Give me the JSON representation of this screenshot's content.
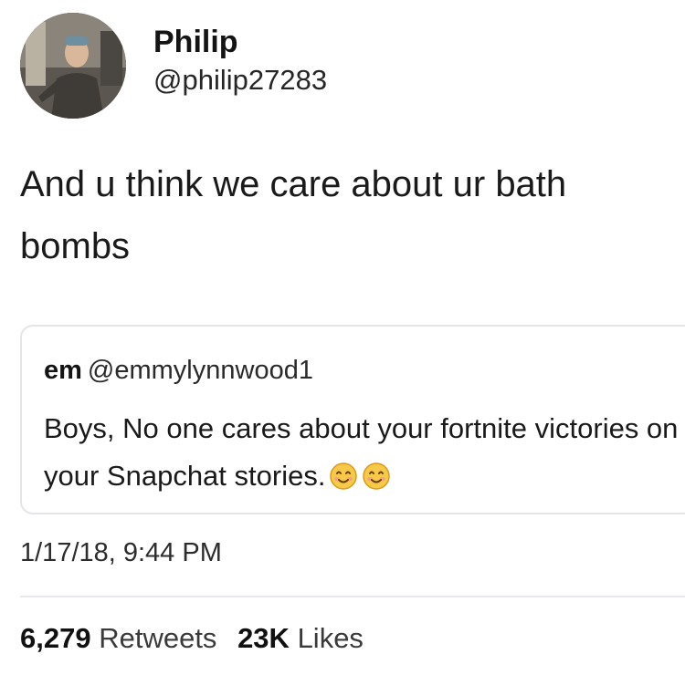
{
  "author": {
    "display_name": "Philip",
    "handle": "@philip27283"
  },
  "tweet_text": "And u think we care about ur bath bombs",
  "quoted_tweet": {
    "display_name": "em",
    "handle": "@emmylynnwood1",
    "text": "Boys, No one cares about your fortnite victories on your Snapchat stories.",
    "emojis": [
      "smiling-face-icon",
      "smiling-face-icon"
    ]
  },
  "timestamp": "1/17/18, 9:44 PM",
  "stats": {
    "retweets_count": "6,279",
    "retweets_label": "Retweets",
    "likes_count": "23K",
    "likes_label": "Likes"
  },
  "colors": {
    "text": "#1c1c1c",
    "border": "#e3e5e8",
    "emoji_fill": "#f7c948"
  }
}
